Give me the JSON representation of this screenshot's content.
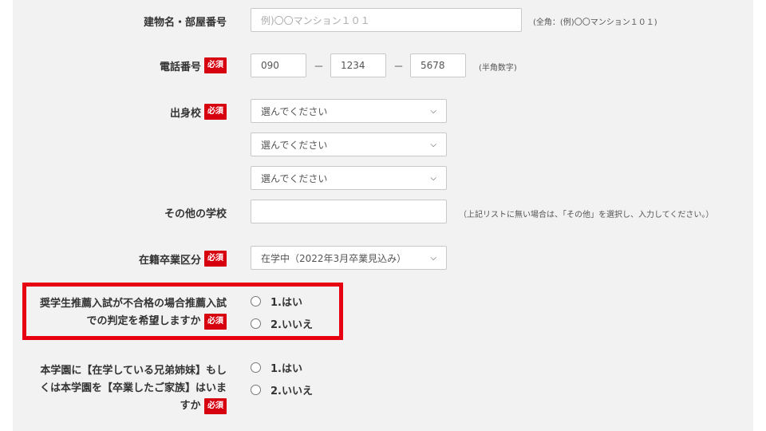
{
  "building": {
    "label": "建物名・部屋番号",
    "placeholder": "例)〇〇マンション１０１",
    "note": "(全角：(例)〇〇マンション１０１)"
  },
  "phone": {
    "label": "電話番号",
    "required": "必須",
    "part1": "090",
    "part2": "1234",
    "part3": "5678",
    "separator": "－",
    "note": "(半角数字)"
  },
  "school": {
    "label": "出身校",
    "required": "必須",
    "select1": "選んでください",
    "select2": "選んでください",
    "select3": "選んでください"
  },
  "other_school": {
    "label": "その他の学校",
    "value": "",
    "note": "（上記リストに無い場合は、「その他」を選択し、入力してください。）"
  },
  "enrollment": {
    "label": "在籍卒業区分",
    "required": "必須",
    "value": "在学中（2022年3月卒業見込み）"
  },
  "scholarship": {
    "label": "奨学生推薦入試が不合格の場合推薦入試での判定を希望しますか",
    "required": "必須",
    "options": [
      "1.はい",
      "2.いいえ"
    ]
  },
  "sibling": {
    "label": "本学園に【在学している兄弟姉妹】もしくは本学園を【卒業したご家族】はいますか",
    "required": "必須",
    "options": [
      "1.はい",
      "2.いいえ"
    ]
  },
  "colors": {
    "required_bg": "#d7000f",
    "highlight": "#e60012",
    "panel": "#f2f2f2"
  },
  "icons": {
    "select_arrow": "chevron-down-icon"
  }
}
